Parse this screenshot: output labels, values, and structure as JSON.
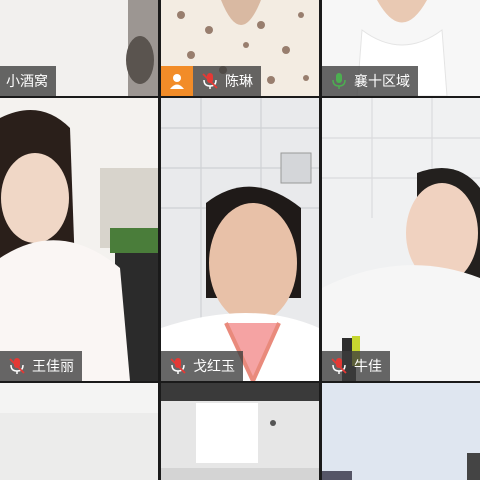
{
  "participants": [
    {
      "name": "小酒窝",
      "mic": "none",
      "host": false
    },
    {
      "name": "陈琳",
      "mic": "muted",
      "host": true
    },
    {
      "name": "襄十区域",
      "mic": "active",
      "host": false
    },
    {
      "name": "王佳丽",
      "mic": "muted",
      "host": false
    },
    {
      "name": "戈红玉",
      "mic": "muted",
      "host": false
    },
    {
      "name": "牛佳",
      "mic": "muted",
      "host": false
    }
  ],
  "colors": {
    "muted_mic": "#e53935",
    "active_mic": "#4caf50",
    "host_badge": "#f28c28",
    "label_bg": "#3c3c3c"
  },
  "icons": {
    "muted_mic": "mic-muted-icon",
    "active_mic": "mic-active-icon",
    "host": "host-person-icon"
  }
}
